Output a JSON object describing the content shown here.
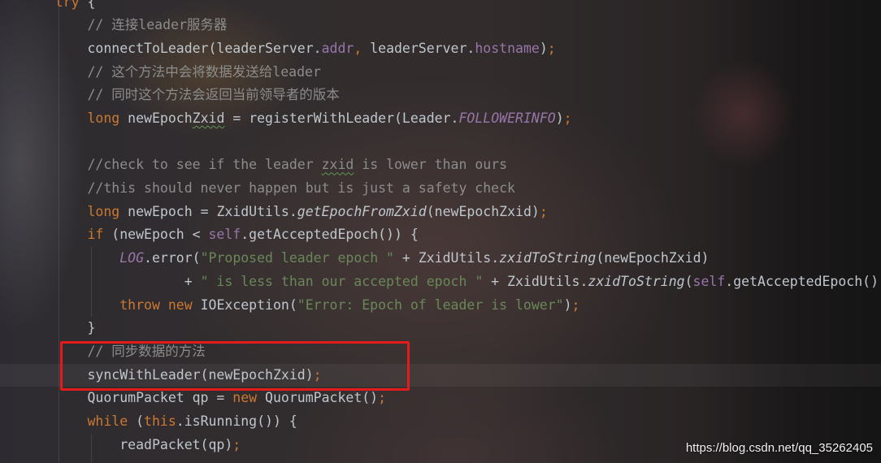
{
  "editor": {
    "lines": [
      {
        "tokens": [
          {
            "text": "    ",
            "type": "text"
          },
          {
            "text": "try",
            "type": "keyword"
          },
          {
            "text": " {",
            "type": "text"
          }
        ]
      },
      {
        "tokens": [
          {
            "text": "        ",
            "type": "text"
          },
          {
            "text": "// 连接leader服务器",
            "type": "comment"
          }
        ]
      },
      {
        "tokens": [
          {
            "text": "        ",
            "type": "text"
          },
          {
            "text": "connectToLeader(leaderServer.",
            "type": "text"
          },
          {
            "text": "addr",
            "type": "field"
          },
          {
            "text": ",",
            "type": "punct"
          },
          {
            "text": " leaderServer.",
            "type": "text"
          },
          {
            "text": "hostname",
            "type": "field"
          },
          {
            "text": ")",
            "type": "text"
          },
          {
            "text": ";",
            "type": "punct"
          }
        ]
      },
      {
        "tokens": [
          {
            "text": "        ",
            "type": "text"
          },
          {
            "text": "// 这个方法中会将数据发送给leader",
            "type": "comment"
          }
        ]
      },
      {
        "tokens": [
          {
            "text": "        ",
            "type": "text"
          },
          {
            "text": "// 同时这个方法会返回当前领导者的版本",
            "type": "comment"
          }
        ]
      },
      {
        "tokens": [
          {
            "text": "        ",
            "type": "text"
          },
          {
            "text": "long",
            "type": "keyword"
          },
          {
            "text": " newEpoch",
            "type": "text"
          },
          {
            "text": "Zxid",
            "type": "text",
            "squiggle": true
          },
          {
            "text": " = registerWithLeader(Leader.",
            "type": "text"
          },
          {
            "text": "FOLLOWERINFO",
            "type": "constant"
          },
          {
            "text": ")",
            "type": "text"
          },
          {
            "text": ";",
            "type": "punct"
          }
        ]
      },
      {
        "tokens": []
      },
      {
        "tokens": [
          {
            "text": "        ",
            "type": "text"
          },
          {
            "text": "//check to see if the leader ",
            "type": "comment"
          },
          {
            "text": "zxid",
            "type": "comment",
            "squiggle": true
          },
          {
            "text": " is lower than ours",
            "type": "comment"
          }
        ]
      },
      {
        "tokens": [
          {
            "text": "        ",
            "type": "text"
          },
          {
            "text": "//this should never happen but is just a safety check",
            "type": "comment"
          }
        ]
      },
      {
        "tokens": [
          {
            "text": "        ",
            "type": "text"
          },
          {
            "text": "long",
            "type": "keyword"
          },
          {
            "text": " newEpoch = ZxidUtils.",
            "type": "text"
          },
          {
            "text": "getEpochFromZxid",
            "type": "static_method"
          },
          {
            "text": "(newEpochZxid)",
            "type": "text"
          },
          {
            "text": ";",
            "type": "punct"
          }
        ]
      },
      {
        "tokens": [
          {
            "text": "        ",
            "type": "text"
          },
          {
            "text": "if",
            "type": "keyword"
          },
          {
            "text": " (newEpoch < ",
            "type": "text"
          },
          {
            "text": "self",
            "type": "field"
          },
          {
            "text": ".getAcceptedEpoch()) {",
            "type": "text"
          }
        ]
      },
      {
        "tokens": [
          {
            "text": "            ",
            "type": "text"
          },
          {
            "text": "LOG",
            "type": "constant"
          },
          {
            "text": ".error(",
            "type": "text"
          },
          {
            "text": "\"Proposed leader epoch \"",
            "type": "string"
          },
          {
            "text": " + ZxidUtils.",
            "type": "text"
          },
          {
            "text": "zxidToString",
            "type": "static_method"
          },
          {
            "text": "(newEpochZxid)",
            "type": "text"
          }
        ]
      },
      {
        "tokens": [
          {
            "text": "                    ",
            "type": "text"
          },
          {
            "text": "+ ",
            "type": "text"
          },
          {
            "text": "\" is less than our accepted epoch \"",
            "type": "string"
          },
          {
            "text": " + ZxidUtils.",
            "type": "text"
          },
          {
            "text": "zxidToString",
            "type": "static_method"
          },
          {
            "text": "(",
            "type": "text"
          },
          {
            "text": "self",
            "type": "field"
          },
          {
            "text": ".getAcceptedEpoch()",
            "type": "text"
          }
        ]
      },
      {
        "tokens": [
          {
            "text": "            ",
            "type": "text"
          },
          {
            "text": "throw",
            "type": "keyword"
          },
          {
            "text": " ",
            "type": "text"
          },
          {
            "text": "new",
            "type": "keyword"
          },
          {
            "text": " IOException(",
            "type": "text"
          },
          {
            "text": "\"Error: Epoch of leader is lower\"",
            "type": "string"
          },
          {
            "text": ")",
            "type": "text"
          },
          {
            "text": ";",
            "type": "punct"
          }
        ]
      },
      {
        "tokens": [
          {
            "text": "        ",
            "type": "text"
          },
          {
            "text": "}",
            "type": "text"
          }
        ]
      },
      {
        "tokens": [
          {
            "text": "        ",
            "type": "text"
          },
          {
            "text": "// 同步数据的方法",
            "type": "comment"
          }
        ]
      },
      {
        "tokens": [
          {
            "text": "        ",
            "type": "text"
          },
          {
            "text": "syncWithLeader(newEpochZxid)",
            "type": "text"
          },
          {
            "text": ";",
            "type": "punct"
          }
        ]
      },
      {
        "tokens": [
          {
            "text": "        ",
            "type": "text"
          },
          {
            "text": "QuorumPacket qp = ",
            "type": "text"
          },
          {
            "text": "new",
            "type": "keyword"
          },
          {
            "text": " QuorumPacket()",
            "type": "text"
          },
          {
            "text": ";",
            "type": "punct"
          }
        ]
      },
      {
        "tokens": [
          {
            "text": "        ",
            "type": "text"
          },
          {
            "text": "while",
            "type": "keyword"
          },
          {
            "text": " (",
            "type": "text"
          },
          {
            "text": "this",
            "type": "keyword"
          },
          {
            "text": ".isRunning()) {",
            "type": "text"
          }
        ]
      },
      {
        "tokens": [
          {
            "text": "            ",
            "type": "text"
          },
          {
            "text": "readPacket(qp)",
            "type": "text"
          },
          {
            "text": ";",
            "type": "punct"
          }
        ]
      }
    ]
  },
  "watermark": {
    "text": "https://blog.csdn.net/qq_35262405"
  },
  "colors": {
    "keyword": "#cc7832",
    "comment": "#8c8c8c",
    "field": "#9876aa",
    "constant": "#9876aa",
    "string": "#6a8759",
    "static_method": "#bfc6cc",
    "text": "#bfc6cc",
    "punct": "#cc7832",
    "squiggle": "#629755",
    "annotation_box": "#e31b1b"
  }
}
